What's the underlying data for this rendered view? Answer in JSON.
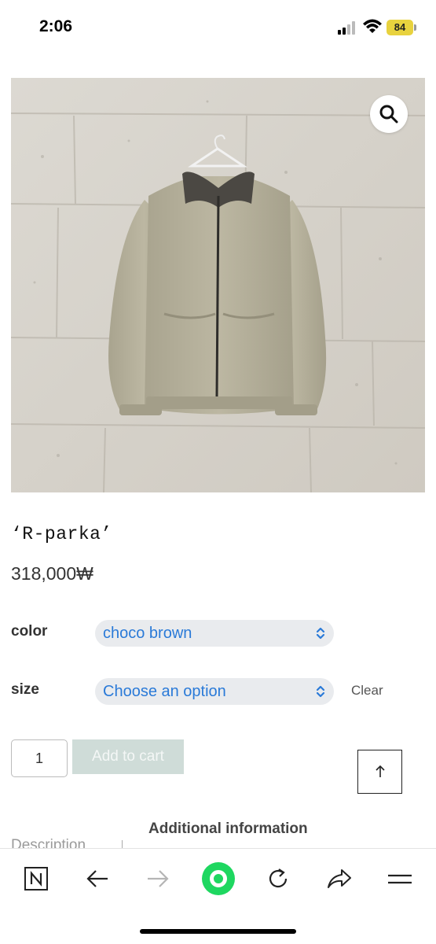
{
  "status_bar": {
    "time": "2:06",
    "battery": "84"
  },
  "product": {
    "title": "‘R-parka’",
    "price": "318,000₩",
    "image_icon": "jacket-photo"
  },
  "variations": {
    "color_label": "color",
    "color_value": "choco brown",
    "size_label": "size",
    "size_value": "Choose an option",
    "clear_label": "Clear"
  },
  "cart": {
    "quantity": "1",
    "add_to_cart_label": "Add to cart"
  },
  "tabs": {
    "description_label": "Description",
    "additional_label": "Additional information"
  },
  "browser_bar": {
    "icons": [
      "naver-n-icon",
      "back-arrow-icon",
      "forward-arrow-icon",
      "green-dot-icon",
      "reload-icon",
      "share-icon",
      "menu-icon"
    ]
  },
  "colors": {
    "select_text": "#2a7ad8",
    "add_to_cart_bg": "#cfdcd8",
    "green_dot": "#1ed760",
    "battery": "#e8d23e"
  }
}
